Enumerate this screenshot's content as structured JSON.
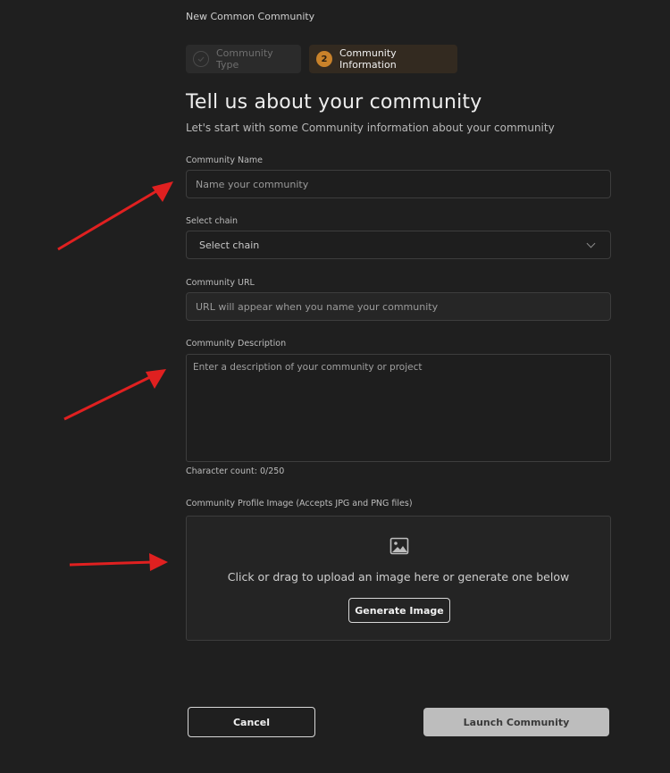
{
  "header": {
    "title": "New Common Community"
  },
  "stepper": {
    "steps": [
      {
        "label": "Community Type",
        "state": "completed",
        "icon": "check-icon"
      },
      {
        "label": "Community Information",
        "state": "active",
        "number": "2"
      }
    ],
    "active_color": "#c9822a"
  },
  "main": {
    "title": "Tell us about your community",
    "subtitle": "Let's start with some Community information about your community"
  },
  "form": {
    "name": {
      "label": "Community Name",
      "placeholder": "Name your community"
    },
    "chain": {
      "label": "Select chain",
      "selected": "Select chain"
    },
    "url": {
      "label": "Community URL",
      "placeholder": "URL will appear when you name your community"
    },
    "description": {
      "label": "Community Description",
      "placeholder": "Enter a description of your community or project",
      "char_count": "Character count: 0/250"
    },
    "image": {
      "label": "Community Profile Image (Accepts JPG and PNG files)",
      "upload_text": "Click or drag to upload an image here or generate one below",
      "generate_label": "Generate Image",
      "icon": "image-icon"
    }
  },
  "footer": {
    "cancel_label": "Cancel",
    "launch_label": "Launch Community"
  },
  "annotations": {
    "arrow_color": "#e02020"
  }
}
